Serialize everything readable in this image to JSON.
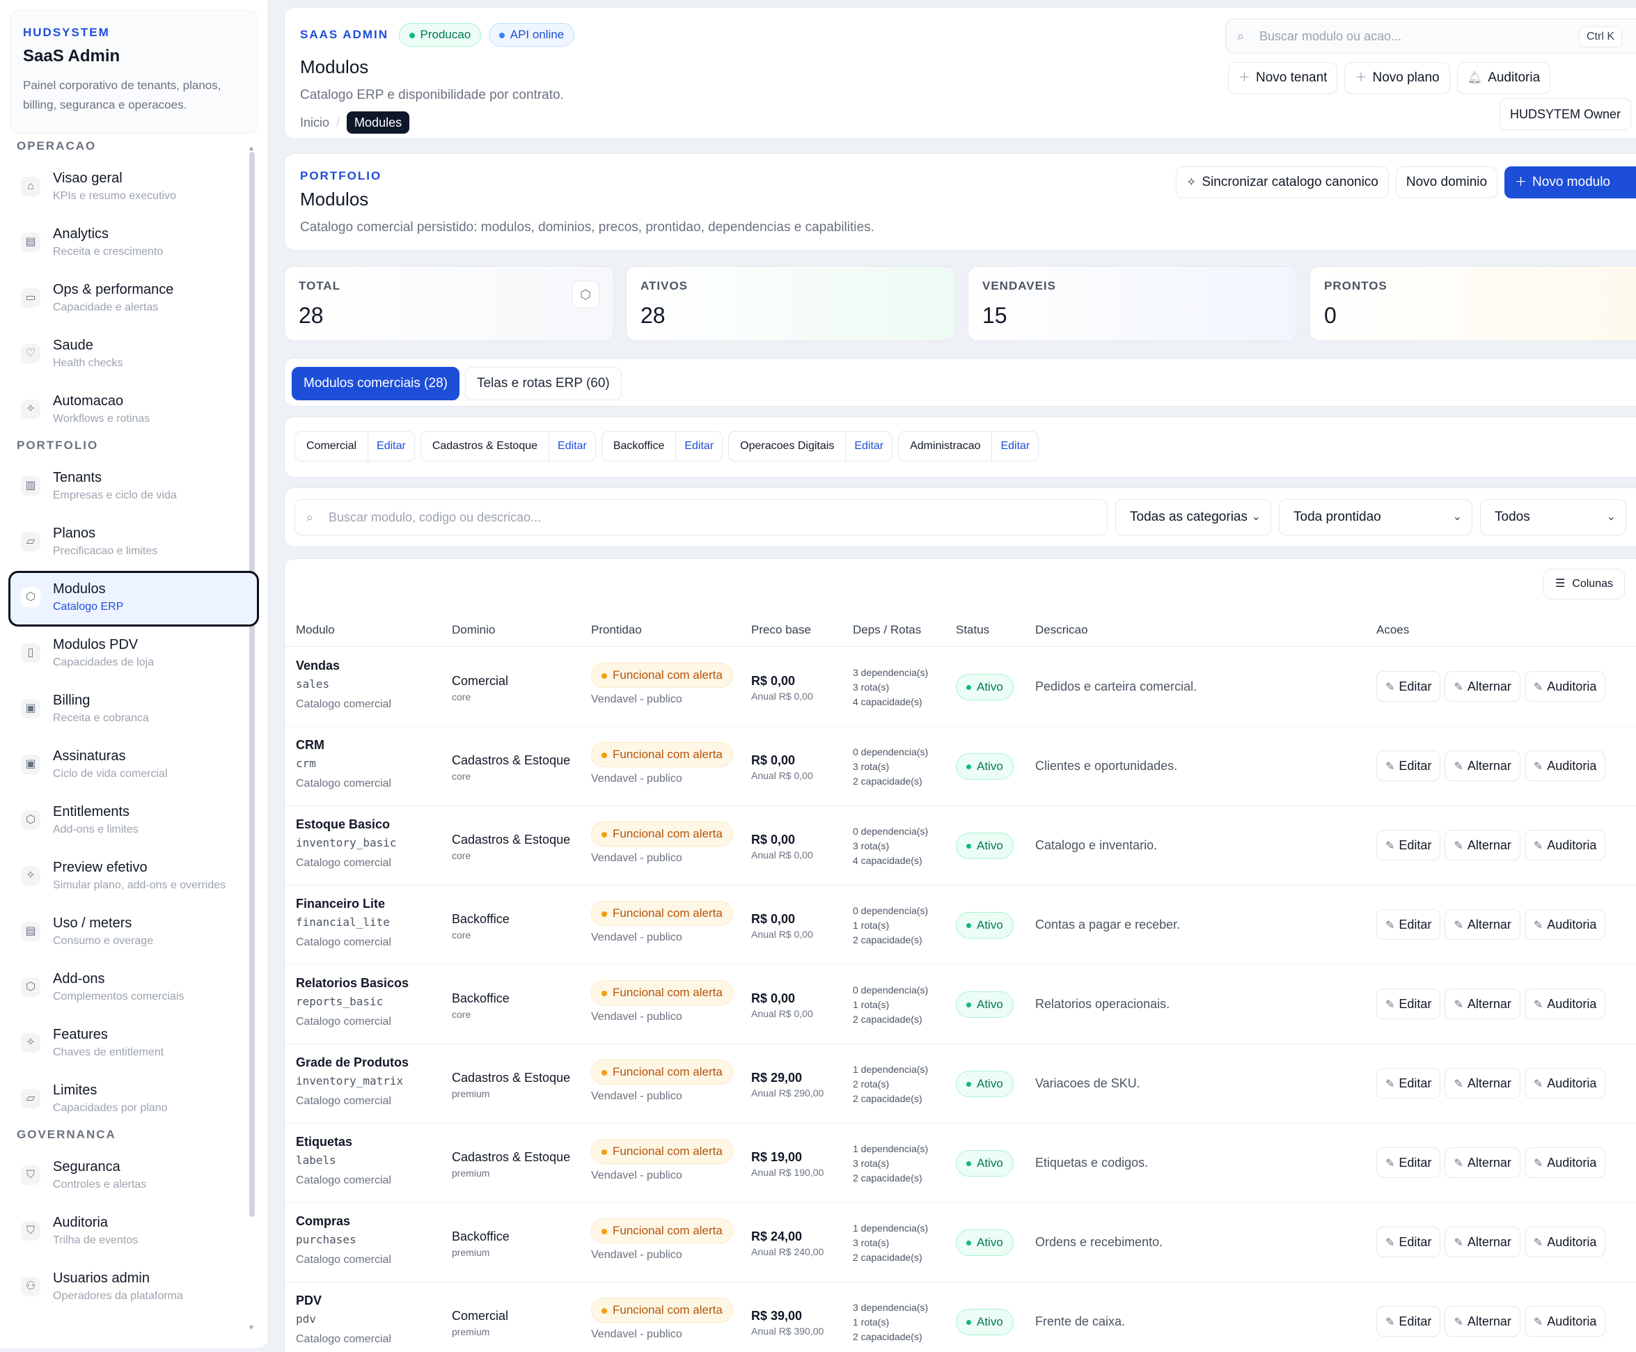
{
  "sidebar": {
    "brand_kicker": "HUDSYSTEM",
    "brand_title": "SaaS Admin",
    "brand_desc": "Painel corporativo de tenants, planos, billing, seguranca e operacoes.",
    "sections": [
      {
        "label": "OPERACAO",
        "items": [
          {
            "title": "Visao geral",
            "sub": "KPIs e resumo executivo",
            "icon": "home-icon"
          },
          {
            "title": "Analytics",
            "sub": "Receita e crescimento",
            "icon": "chart-icon"
          },
          {
            "title": "Ops & performance",
            "sub": "Capacidade e alertas",
            "icon": "server-icon"
          },
          {
            "title": "Saude",
            "sub": "Health checks",
            "icon": "heart-icon"
          },
          {
            "title": "Automacao",
            "sub": "Workflows e rotinas",
            "icon": "sparkles-icon"
          }
        ]
      },
      {
        "label": "PORTFOLIO",
        "items": [
          {
            "title": "Tenants",
            "sub": "Empresas e ciclo de vida",
            "icon": "building-icon"
          },
          {
            "title": "Planos",
            "sub": "Precificacao e limites",
            "icon": "layers-icon"
          },
          {
            "title": "Modulos",
            "sub": "Catalogo ERP",
            "icon": "cube-icon",
            "active": true
          },
          {
            "title": "Modulos PDV",
            "sub": "Capacidades de loja",
            "icon": "phone-icon"
          },
          {
            "title": "Billing",
            "sub": "Receita e cobranca",
            "icon": "billing-icon"
          },
          {
            "title": "Assinaturas",
            "sub": "Ciclo de vida comercial",
            "icon": "subscription-icon"
          },
          {
            "title": "Entitlements",
            "sub": "Add-ons e limites",
            "icon": "cube-icon"
          },
          {
            "title": "Preview efetivo",
            "sub": "Simular plano, add-ons e overrides",
            "icon": "sparkles-icon"
          },
          {
            "title": "Uso / meters",
            "sub": "Consumo e overage",
            "icon": "chart-icon"
          },
          {
            "title": "Add-ons",
            "sub": "Complementos comerciais",
            "icon": "cube-icon"
          },
          {
            "title": "Features",
            "sub": "Chaves de entitlement",
            "icon": "sparkles-icon"
          },
          {
            "title": "Limites",
            "sub": "Capacidades por plano",
            "icon": "layers-icon"
          }
        ]
      },
      {
        "label": "GOVERNANCA",
        "items": [
          {
            "title": "Seguranca",
            "sub": "Controles e alertas",
            "icon": "shield-icon"
          },
          {
            "title": "Auditoria",
            "sub": "Trilha de eventos",
            "icon": "shield-icon"
          },
          {
            "title": "Usuarios admin",
            "sub": "Operadores da plataforma",
            "icon": "users-icon"
          }
        ]
      }
    ]
  },
  "header": {
    "kicker": "SAAS ADMIN",
    "pill_env": "Producao",
    "pill_api": "API online",
    "title": "Modulos",
    "desc": "Catalogo ERP e disponibilidade por contrato.",
    "crumb_home": "Inicio",
    "crumb_sep": "/",
    "crumb_current": "Modules",
    "search_placeholder": "Buscar modulo ou acao...",
    "search_shortcut": "Ctrl K",
    "btn_new_tenant": "Novo tenant",
    "btn_new_plan": "Novo plano",
    "btn_audit": "Auditoria",
    "owner": "HUDSYTEM Owner"
  },
  "portfolio": {
    "kicker": "PORTFOLIO",
    "title": "Modulos",
    "desc": "Catalogo comercial persistido: modulos, dominios, precos, prontidao, dependencias e capabilities.",
    "btn_sync": "Sincronizar catalogo canonico",
    "btn_new_domain": "Novo dominio",
    "btn_new_module": "Novo modulo"
  },
  "stats": [
    {
      "label": "TOTAL",
      "value": "28"
    },
    {
      "label": "ATIVOS",
      "value": "28"
    },
    {
      "label": "VENDAVEIS",
      "value": "15"
    },
    {
      "label": "PRONTOS",
      "value": "0"
    }
  ],
  "tabs": [
    "Modulos comerciais (28)",
    "Telas e rotas ERP (60)"
  ],
  "domains": {
    "edit_label": "Editar",
    "items": [
      "Comercial",
      "Cadastros & Estoque",
      "Backoffice",
      "Operacoes Digitais",
      "Administracao"
    ]
  },
  "filters": {
    "search_placeholder": "Buscar modulo, codigo ou descricao...",
    "category": "Todas as categorias",
    "readiness": "Toda prontidao",
    "status": "Todos"
  },
  "table": {
    "columns_btn": "Colunas",
    "headers": [
      "Modulo",
      "Dominio",
      "Prontidao",
      "Preco base",
      "Deps / Rotas",
      "Status",
      "Descricao",
      "Acoes"
    ],
    "action_labels": [
      "Editar",
      "Alternar",
      "Auditoria"
    ],
    "rows": [
      {
        "name": "Vendas",
        "code": "sales",
        "cat": "Catalogo comercial",
        "domain": "Comercial",
        "tier": "core",
        "ready": "Funcional com alerta",
        "vend": "Vendavel - publico",
        "price": "R$ 0,00",
        "annual": "Anual R$ 0,00",
        "deps": "3 dependencia(s)",
        "rotas": "3 rota(s)",
        "caps": "4 capacidade(s)",
        "status": "Ativo",
        "desc": "Pedidos e carteira comercial."
      },
      {
        "name": "CRM",
        "code": "crm",
        "cat": "Catalogo comercial",
        "domain": "Cadastros & Estoque",
        "tier": "core",
        "ready": "Funcional com alerta",
        "vend": "Vendavel - publico",
        "price": "R$ 0,00",
        "annual": "Anual R$ 0,00",
        "deps": "0 dependencia(s)",
        "rotas": "3 rota(s)",
        "caps": "2 capacidade(s)",
        "status": "Ativo",
        "desc": "Clientes e oportunidades."
      },
      {
        "name": "Estoque Basico",
        "code": "inventory_basic",
        "cat": "Catalogo comercial",
        "domain": "Cadastros & Estoque",
        "tier": "core",
        "ready": "Funcional com alerta",
        "vend": "Vendavel - publico",
        "price": "R$ 0,00",
        "annual": "Anual R$ 0,00",
        "deps": "0 dependencia(s)",
        "rotas": "3 rota(s)",
        "caps": "4 capacidade(s)",
        "status": "Ativo",
        "desc": "Catalogo e inventario."
      },
      {
        "name": "Financeiro Lite",
        "code": "financial_lite",
        "cat": "Catalogo comercial",
        "domain": "Backoffice",
        "tier": "core",
        "ready": "Funcional com alerta",
        "vend": "Vendavel - publico",
        "price": "R$ 0,00",
        "annual": "Anual R$ 0,00",
        "deps": "0 dependencia(s)",
        "rotas": "1 rota(s)",
        "caps": "2 capacidade(s)",
        "status": "Ativo",
        "desc": "Contas a pagar e receber."
      },
      {
        "name": "Relatorios Basicos",
        "code": "reports_basic",
        "cat": "Catalogo comercial",
        "domain": "Backoffice",
        "tier": "core",
        "ready": "Funcional com alerta",
        "vend": "Vendavel - publico",
        "price": "R$ 0,00",
        "annual": "Anual R$ 0,00",
        "deps": "0 dependencia(s)",
        "rotas": "1 rota(s)",
        "caps": "2 capacidade(s)",
        "status": "Ativo",
        "desc": "Relatorios operacionais."
      },
      {
        "name": "Grade de Produtos",
        "code": "inventory_matrix",
        "cat": "Catalogo comercial",
        "domain": "Cadastros & Estoque",
        "tier": "premium",
        "ready": "Funcional com alerta",
        "vend": "Vendavel - publico",
        "price": "R$ 29,00",
        "annual": "Anual R$ 290,00",
        "deps": "1 dependencia(s)",
        "rotas": "2 rota(s)",
        "caps": "2 capacidade(s)",
        "status": "Ativo",
        "desc": "Variacoes de SKU."
      },
      {
        "name": "Etiquetas",
        "code": "labels",
        "cat": "Catalogo comercial",
        "domain": "Cadastros & Estoque",
        "tier": "premium",
        "ready": "Funcional com alerta",
        "vend": "Vendavel - publico",
        "price": "R$ 19,00",
        "annual": "Anual R$ 190,00",
        "deps": "1 dependencia(s)",
        "rotas": "3 rota(s)",
        "caps": "2 capacidade(s)",
        "status": "Ativo",
        "desc": "Etiquetas e codigos."
      },
      {
        "name": "Compras",
        "code": "purchases",
        "cat": "Catalogo comercial",
        "domain": "Backoffice",
        "tier": "premium",
        "ready": "Funcional com alerta",
        "vend": "Vendavel - publico",
        "price": "R$ 24,00",
        "annual": "Anual R$ 240,00",
        "deps": "1 dependencia(s)",
        "rotas": "3 rota(s)",
        "caps": "2 capacidade(s)",
        "status": "Ativo",
        "desc": "Ordens e recebimento."
      },
      {
        "name": "PDV",
        "code": "pdv",
        "cat": "Catalogo comercial",
        "domain": "Comercial",
        "tier": "premium",
        "ready": "Funcional com alerta",
        "vend": "Vendavel - publico",
        "price": "R$ 39,00",
        "annual": "Anual R$ 390,00",
        "deps": "3 dependencia(s)",
        "rotas": "1 rota(s)",
        "caps": "2 capacidade(s)",
        "status": "Ativo",
        "desc": "Frente de caixa."
      }
    ]
  },
  "colors": {
    "accent": "#1d4ed8",
    "success": "#047857",
    "warning": "#b45309",
    "dark": "#0f172a"
  }
}
